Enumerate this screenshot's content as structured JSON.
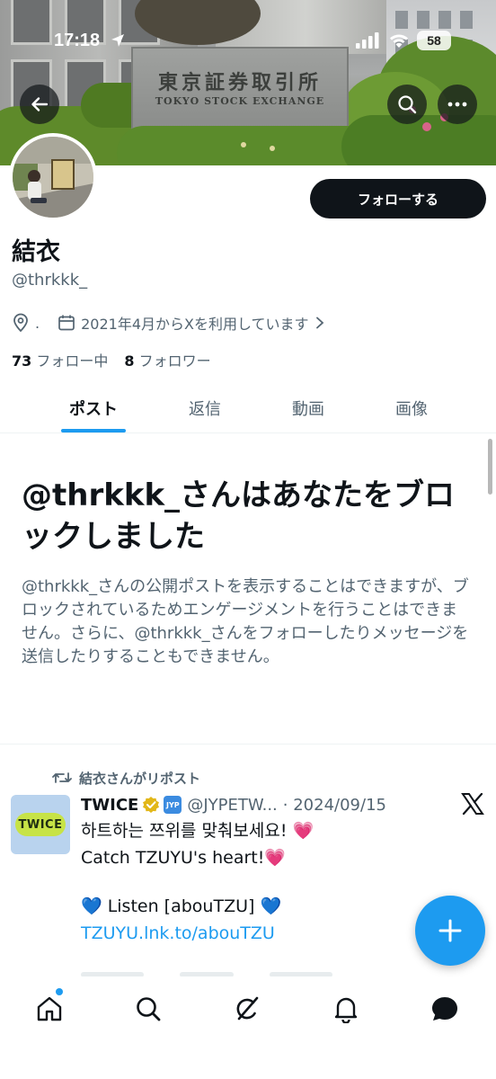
{
  "status_bar": {
    "time": "17:18",
    "battery": "58"
  },
  "banner": {
    "sign_title": "東京証券取引所",
    "sign_subtitle": "TOKYO STOCK EXCHANGE",
    "icons": [
      "back-arrow-icon",
      "search-icon",
      "more-icon"
    ]
  },
  "profile": {
    "display_name": "結衣",
    "handle": "@thrkkk_",
    "location": ".",
    "joined": "2021年4月からXを利用しています",
    "following_count": "73",
    "following_label": "フォロー中",
    "followers_count": "8",
    "followers_label": "フォロワー",
    "follow_button": "フォローする"
  },
  "tabs": [
    {
      "label": "ポスト",
      "active": true
    },
    {
      "label": "返信",
      "active": false
    },
    {
      "label": "動画",
      "active": false
    },
    {
      "label": "画像",
      "active": false
    }
  ],
  "blocked": {
    "title": "@thrkkk_さんはあなたをブロックしました",
    "body": "@thrkkk_さんの公開ポストを表示することはできますが、ブロックされているためエンゲージメントを行うことはできません。さらに、@thrkkk_さんをフォローしたりメッセージを送信したりすることもできません。"
  },
  "post": {
    "repost_label": "結衣さんがリポスト",
    "author_name": "TWICE",
    "affiliate_badge": "JYP",
    "author_handle": "@JYPETW...",
    "date": "· 2024/09/15",
    "avatar_text": "TWICE",
    "lines": [
      "하트하는 쯔위를 맞춰보세요! 💗",
      "Catch TZUYU's heart!💗",
      "💙 Listen [abouTZU] 💙"
    ],
    "link": "TZUYU.lnk.to/abouTZU"
  },
  "colors": {
    "accent": "#1d9bf0",
    "text_primary": "#0f1419",
    "text_secondary": "#536471",
    "follow_button_bg": "#0f1419"
  },
  "bottom_nav": [
    "home-icon",
    "search-icon",
    "grok-icon",
    "notifications-icon",
    "messages-icon"
  ]
}
